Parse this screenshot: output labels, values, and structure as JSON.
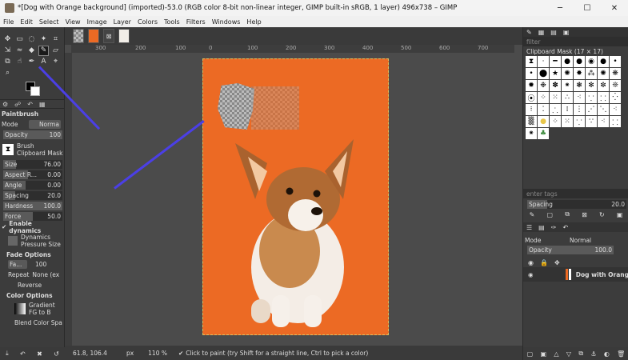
{
  "window": {
    "title": "*[Dog with Orange background] (imported)-53.0 (RGB color 8-bit non-linear integer, GIMP built-in sRGB, 1 layer) 496x738 – GIMP"
  },
  "menu": [
    "File",
    "Edit",
    "Select",
    "View",
    "Image",
    "Layer",
    "Colors",
    "Tools",
    "Filters",
    "Windows",
    "Help"
  ],
  "tool_options": {
    "title": "Paintbrush",
    "mode_label": "Mode",
    "mode_value": "Norma",
    "opacity_label": "Opacity",
    "opacity_value": "100",
    "brush_label": "Brush",
    "brush_value": "Clipboard Mask",
    "size_label": "Size",
    "size_value": "76.00",
    "aspect_label": "Aspect R...",
    "aspect_value": "0.00",
    "angle_label": "Angle",
    "angle_value": "0.00",
    "spacing_label": "Spacing",
    "spacing_value": "20.0",
    "hardness_label": "Hardness",
    "hardness_value": "100.0",
    "force_label": "Force",
    "force_value": "50.0",
    "enable_dynamics": "Enable dynamics",
    "dynamics_label": "Dynamics",
    "dynamics_value": "Pressure Size",
    "fade_options": "Fade Options",
    "fade_label": "Fa...",
    "fade_value": "100",
    "repeat_label": "Repeat",
    "repeat_value": "None (ex",
    "reverse": "Reverse",
    "color_options": "Color Options",
    "gradient_label": "Gradient",
    "gradient_value": "FG to B",
    "blend_label": "Blend Color Spa"
  },
  "status": {
    "coords": "61.8, 106.4",
    "unit": "px",
    "zoom": "110 %",
    "message": "Click to paint (try Shift for a straight line, Ctrl to pick a color)"
  },
  "ruler": [
    "300",
    "200",
    "100",
    "0",
    "100",
    "200",
    "300",
    "400",
    "500",
    "600",
    "700"
  ],
  "brushes": {
    "filter_placeholder": "filter",
    "title": "Clipboard Mask (17 × 17)",
    "tags_placeholder": "enter tags",
    "spacing_label": "Spacing",
    "spacing_value": "20.0"
  },
  "layers": {
    "mode_label": "Mode",
    "mode_value": "Normal",
    "opacity_label": "Opacity",
    "opacity_value": "100.0",
    "layer_name": "Dog with Orang"
  },
  "colors": {
    "canvas_bg": "#ec6a24",
    "annotation_arrow": "#4b3fe6",
    "fg": "#000000",
    "bg": "#ffffff"
  }
}
